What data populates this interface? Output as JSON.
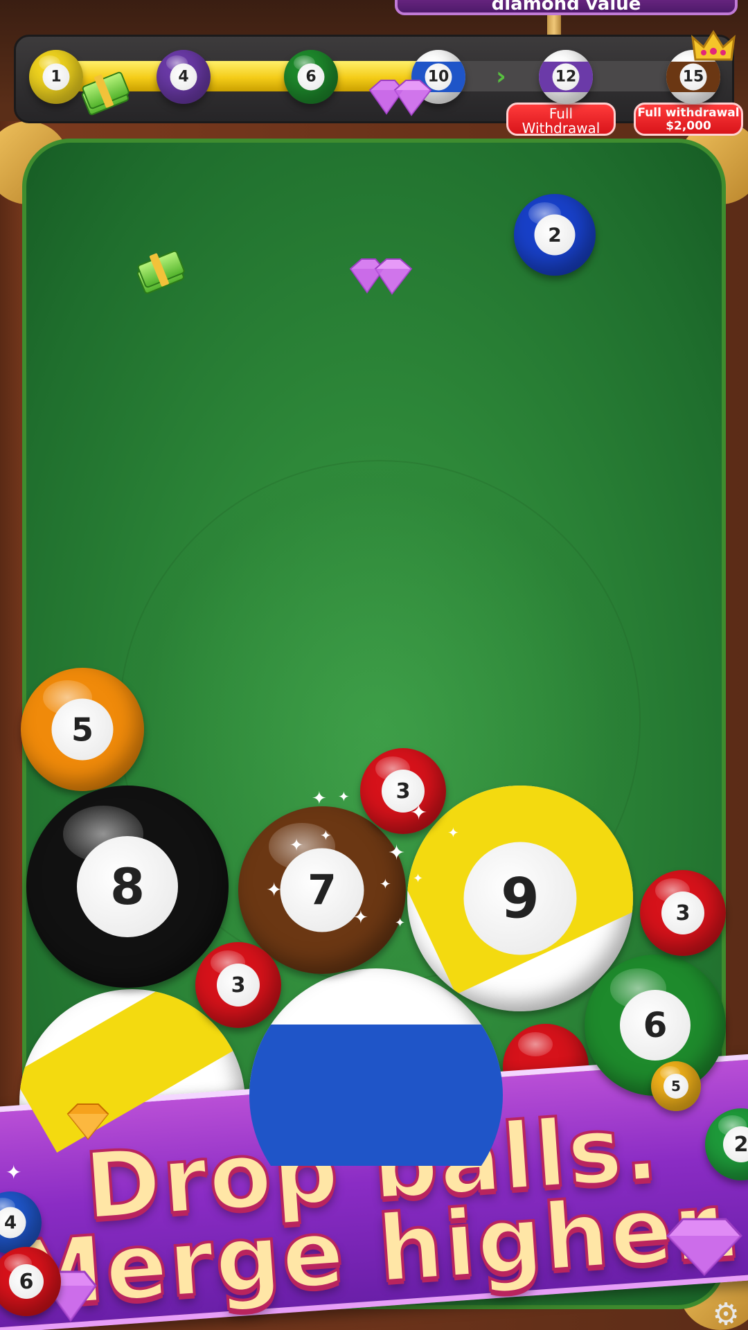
{
  "top_label": {
    "text": "diamond value"
  },
  "progress": {
    "fill_fraction": 0.63,
    "milestones": [
      {
        "number": "1",
        "color": "#f2d51f"
      },
      {
        "number": "4",
        "color": "#6b3aa8"
      },
      {
        "number": "6",
        "color": "#1e8a2c"
      },
      {
        "number": "10",
        "color": "#1f55c8",
        "striped": true
      },
      {
        "number": "12",
        "color": "#6b3aa8",
        "striped": true
      },
      {
        "number": "15",
        "color": "#6b3713",
        "striped": true
      }
    ],
    "badges": {
      "full_withdrawal": "Full\nWithdrawal",
      "full_withdrawal_2000_line1": "Full withdrawal",
      "full_withdrawal_2000_line2": "$2,000"
    },
    "arrow": "›"
  },
  "next_ball": {
    "number": "2",
    "color": "#1840c8"
  },
  "board_balls": [
    {
      "number": "5",
      "color": "#f08a0a"
    },
    {
      "number": "8",
      "color": "#111111"
    },
    {
      "number": "3",
      "color": "#d6121a"
    },
    {
      "number": "7",
      "color": "#6b3713"
    },
    {
      "number": "9",
      "color": "#f3da10"
    },
    {
      "number": "3",
      "color": "#d6121a"
    },
    {
      "number": "3",
      "color": "#d6121a"
    },
    {
      "number": "6",
      "color": "#1e8a2c"
    }
  ],
  "banner": {
    "line1": "Drop balls.",
    "line2": "Merge higher."
  },
  "banner_balls": [
    {
      "number": "5",
      "color": "#f2b21a"
    },
    {
      "number": "2",
      "color": "#1e9a3a"
    },
    {
      "number": "4",
      "color": "#1f55c8"
    },
    {
      "number": "6",
      "color": "#d6121a"
    }
  ],
  "icons": {
    "settings": "gear-icon",
    "cash": "cash-icon",
    "diamond": "diamond-icon",
    "crown": "crown-icon"
  }
}
